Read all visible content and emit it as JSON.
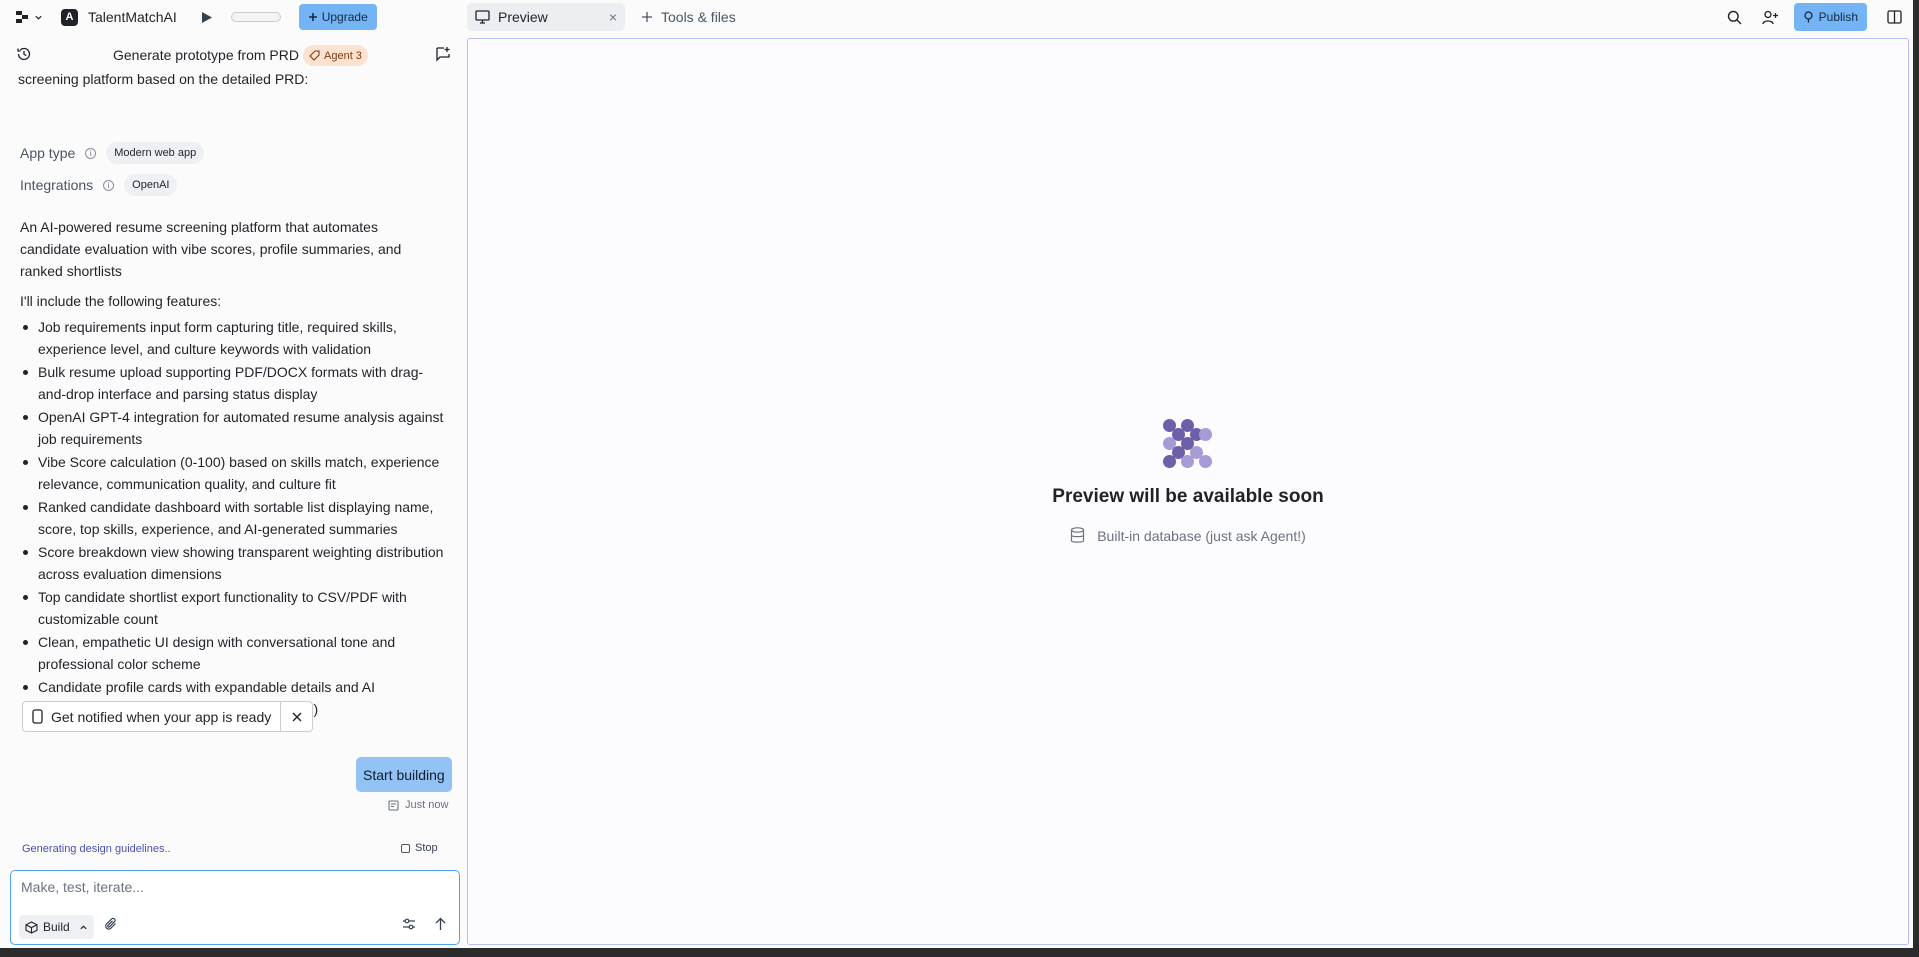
{
  "topbar": {
    "app_name": "TalentMatchAI",
    "app_initial": "A",
    "upgrade_label": "Upgrade",
    "publish_label": "Publish"
  },
  "tabs": {
    "preview_label": "Preview",
    "tools_label": "Tools & files"
  },
  "chat": {
    "title": "Generate prototype from PRD",
    "agent_badge": "Agent 3",
    "truncated_line": "screening platform based on the detailed PRD:",
    "app_type_label": "App type",
    "app_type_value": "Modern web app",
    "integrations_label": "Integrations",
    "integrations_value": "OpenAI",
    "summary": "An AI-powered resume screening platform that automates candidate evaluation with vibe scores, profile summaries, and ranked shortlists",
    "features_title": "I'll include the following features:",
    "features": [
      "Job requirements input form capturing title, required skills, experience level, and culture keywords with validation",
      "Bulk resume upload supporting PDF/DOCX formats with drag-and-drop interface and parsing status display",
      "OpenAI GPT-4 integration for automated resume analysis against job requirements",
      "Vibe Score calculation (0-100) based on skills match, experience relevance, communication quality, and culture fit",
      "Ranked candidate dashboard with sortable list displaying name, score, top skills, experience, and AI-generated summaries",
      "Score breakdown view showing transparent weighting distribution across evaluation dimensions",
      "Top candidate shortlist export functionality to CSV/PDF with customizable count",
      "Clean, empathetic UI design with conversational tone and professional color scheme",
      "Candidate profile cards with expandable details and AI recommendations (Strong Fit/Consider/Pass)"
    ],
    "notify_label": "Get notified when your app is ready",
    "start_button": "Start building",
    "timestamp": "Just now",
    "status": "Generating design guidelines..",
    "stop_label": "Stop"
  },
  "composer": {
    "placeholder": "Make, test, iterate...",
    "mode_label": "Build"
  },
  "preview": {
    "title": "Preview will be available soon",
    "db_note": "Built-in database (just ask Agent!)"
  },
  "colors": {
    "accent_blue": "#74b4f4",
    "badge_bg": "#fde3cf",
    "logo_dark": "#6e5fa8",
    "logo_light": "#a89ad6"
  }
}
